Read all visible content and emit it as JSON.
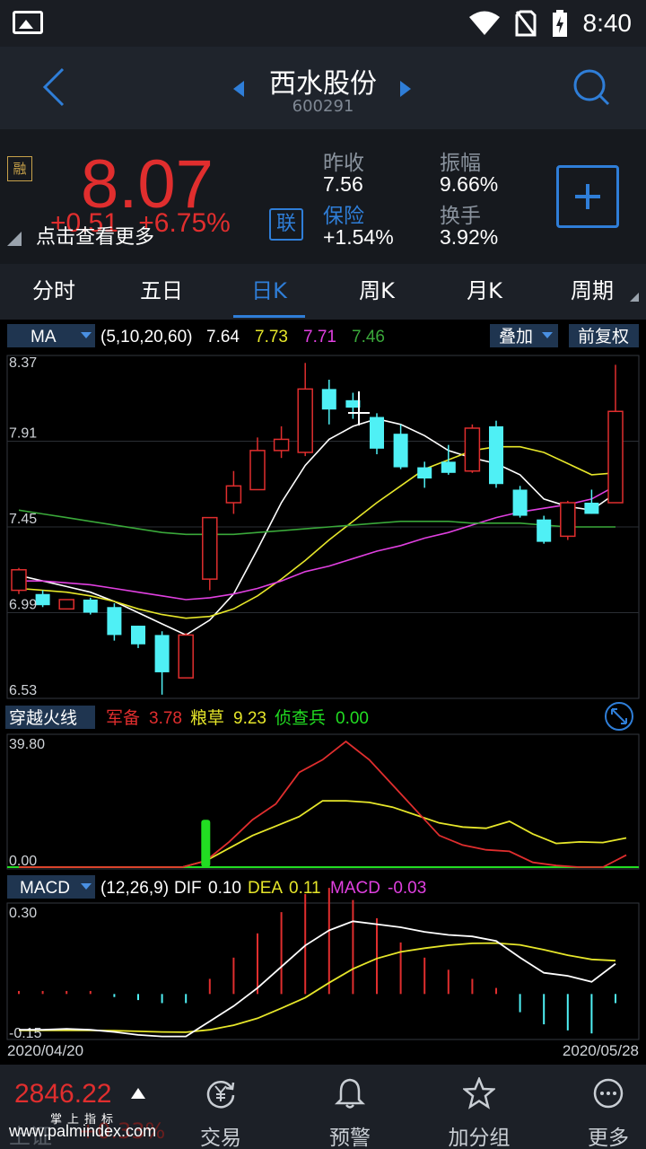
{
  "status": {
    "time": "8:40"
  },
  "header": {
    "title": "西水股份",
    "code": "600291"
  },
  "quote": {
    "rong": "融",
    "price": "8.07",
    "change": "+0.51",
    "change_pct": "+6.75%",
    "tip": "点击查看更多",
    "lian": "联",
    "stats": [
      {
        "label": "昨收",
        "value": "7.56"
      },
      {
        "label": "振幅",
        "value": "9.66%"
      },
      {
        "label": "保险",
        "value": "+1.54%"
      },
      {
        "label": "换手",
        "value": "3.92%"
      }
    ]
  },
  "tabs": [
    "分时",
    "五日",
    "日K",
    "周K",
    "月K",
    "周期"
  ],
  "active_tab": "日K",
  "ma_bar": {
    "name": "MA",
    "params": "(5,10,20,60)",
    "values": [
      "7.64",
      "7.73",
      "7.71",
      "7.46"
    ],
    "overlay": "叠加",
    "adjust": "前复权"
  },
  "ind1": {
    "name": "穿越火线",
    "items": [
      {
        "label": "军备",
        "value": "3.78"
      },
      {
        "label": "粮草",
        "value": "9.23"
      },
      {
        "label": "侦查兵",
        "value": "0.00"
      }
    ],
    "top": "39.80",
    "bottom": "0.00"
  },
  "macd": {
    "name": "MACD",
    "params": "(12,26,9)",
    "dif_label": "DIF",
    "dif": "0.10",
    "dea_label": "DEA",
    "dea": "0.11",
    "macd_label": "MACD",
    "macd": "-0.03",
    "top": "0.30",
    "bottom": "-0.15",
    "date_start": "2020/04/20",
    "date_end": "2020/05/28"
  },
  "colors": {
    "up": "#e02e2e",
    "down": "#4ff0f5",
    "ma5": "#ffffff",
    "ma10": "#e6e62a",
    "ma20": "#e040e0",
    "ma60": "#3aa83a",
    "accent": "#2f7ed8"
  },
  "chart_data": {
    "type": "candlestick",
    "y_ticks": [
      "8.37",
      "7.91",
      "7.45",
      "6.99",
      "6.53"
    ],
    "ylim": [
      6.53,
      8.37
    ],
    "candles": [
      {
        "o": 7.11,
        "c": 7.22,
        "h": 7.23,
        "l": 7.09
      },
      {
        "o": 7.09,
        "c": 7.03,
        "h": 7.11,
        "l": 7.02
      },
      {
        "o": 7.01,
        "c": 7.06,
        "h": 7.06,
        "l": 7.01
      },
      {
        "o": 7.06,
        "c": 6.99,
        "h": 7.07,
        "l": 6.98
      },
      {
        "o": 7.02,
        "c": 6.87,
        "h": 7.04,
        "l": 6.84
      },
      {
        "o": 6.92,
        "c": 6.82,
        "h": 6.92,
        "l": 6.8
      },
      {
        "o": 6.87,
        "c": 6.67,
        "h": 6.89,
        "l": 6.55
      },
      {
        "o": 6.64,
        "c": 6.87,
        "h": 6.88,
        "l": 6.64
      },
      {
        "o": 7.17,
        "c": 7.5,
        "h": 7.5,
        "l": 7.11
      },
      {
        "o": 7.58,
        "c": 7.67,
        "h": 7.75,
        "l": 7.52
      },
      {
        "o": 7.65,
        "c": 7.86,
        "h": 7.93,
        "l": 7.65
      },
      {
        "o": 7.86,
        "c": 7.92,
        "h": 7.99,
        "l": 7.82
      },
      {
        "o": 7.85,
        "c": 8.19,
        "h": 8.33,
        "l": 7.83
      },
      {
        "o": 8.19,
        "c": 8.08,
        "h": 8.24,
        "l": 8.0
      },
      {
        "o": 8.13,
        "c": 8.09,
        "h": 8.17,
        "l": 8.03
      },
      {
        "o": 8.04,
        "c": 7.87,
        "h": 8.06,
        "l": 7.84
      },
      {
        "o": 7.95,
        "c": 7.77,
        "h": 8.0,
        "l": 7.76
      },
      {
        "o": 7.77,
        "c": 7.71,
        "h": 7.8,
        "l": 7.66
      },
      {
        "o": 7.8,
        "c": 7.74,
        "h": 7.89,
        "l": 7.73
      },
      {
        "o": 7.75,
        "c": 7.98,
        "h": 8.0,
        "l": 7.74
      },
      {
        "o": 7.99,
        "c": 7.68,
        "h": 8.02,
        "l": 7.66
      },
      {
        "o": 7.65,
        "c": 7.51,
        "h": 7.67,
        "l": 7.5
      },
      {
        "o": 7.49,
        "c": 7.37,
        "h": 7.51,
        "l": 7.36
      },
      {
        "o": 7.4,
        "c": 7.58,
        "h": 7.59,
        "l": 7.38
      },
      {
        "o": 7.58,
        "c": 7.52,
        "h": 7.65,
        "l": 7.52
      },
      {
        "o": 7.58,
        "c": 8.07,
        "h": 8.32,
        "l": 7.58
      }
    ],
    "ma": [
      {
        "name": "MA5",
        "color": "#ffffff",
        "values": [
          7.19,
          7.16,
          7.13,
          7.1,
          7.05,
          6.99,
          6.93,
          6.87,
          6.95,
          7.09,
          7.33,
          7.58,
          7.78,
          7.92,
          7.99,
          8.03,
          8.0,
          7.94,
          7.86,
          7.82,
          7.79,
          7.73,
          7.6,
          7.56,
          7.54,
          7.63
        ]
      },
      {
        "name": "MA10",
        "color": "#e6e62a",
        "values": [
          7.12,
          7.11,
          7.1,
          7.08,
          7.05,
          7.01,
          6.98,
          6.96,
          6.97,
          7.01,
          7.08,
          7.17,
          7.27,
          7.38,
          7.48,
          7.58,
          7.67,
          7.76,
          7.81,
          7.86,
          7.88,
          7.88,
          7.85,
          7.79,
          7.73,
          7.74
        ]
      },
      {
        "name": "MA20",
        "color": "#e040e0",
        "values": [
          7.16,
          7.16,
          7.15,
          7.14,
          7.12,
          7.1,
          7.08,
          7.06,
          7.07,
          7.09,
          7.12,
          7.16,
          7.21,
          7.24,
          7.28,
          7.32,
          7.35,
          7.39,
          7.42,
          7.46,
          7.5,
          7.53,
          7.55,
          7.57,
          7.6,
          7.67
        ]
      },
      {
        "name": "MA60",
        "color": "#3aa83a",
        "values": [
          7.54,
          7.52,
          7.5,
          7.48,
          7.46,
          7.44,
          7.42,
          7.41,
          7.41,
          7.41,
          7.42,
          7.43,
          7.44,
          7.45,
          7.46,
          7.47,
          7.48,
          7.48,
          7.48,
          7.47,
          7.47,
          7.47,
          7.46,
          7.45,
          7.45,
          7.45
        ]
      }
    ],
    "ind1": {
      "ylim": [
        0,
        39.8
      ],
      "red": [
        0,
        0,
        0,
        0,
        0,
        0,
        0,
        0,
        2,
        8,
        15,
        20,
        30,
        34,
        39.8,
        34,
        26,
        18,
        10,
        7,
        5.5,
        5,
        1.5,
        0.5,
        0,
        0,
        3.8
      ],
      "yellow": [
        0,
        0,
        0,
        0,
        0,
        0,
        0,
        0,
        2,
        6,
        10,
        13,
        16,
        21,
        21,
        20.5,
        19,
        16.5,
        14,
        12.7,
        12.3,
        14.5,
        10.5,
        7.5,
        8,
        7.8,
        9.23
      ],
      "green_bar_index": 8,
      "green_bar_value": 15
    },
    "macd": {
      "ylim": [
        -0.15,
        0.3
      ],
      "dif": [
        -0.118,
        -0.118,
        -0.115,
        -0.118,
        -0.125,
        -0.135,
        -0.14,
        -0.14,
        -0.09,
        -0.04,
        0.02,
        0.09,
        0.16,
        0.21,
        0.24,
        0.23,
        0.22,
        0.205,
        0.195,
        0.19,
        0.175,
        0.12,
        0.07,
        0.06,
        0.04,
        0.1
      ],
      "dea": [
        -0.12,
        -0.12,
        -0.12,
        -0.12,
        -0.121,
        -0.123,
        -0.125,
        -0.126,
        -0.118,
        -0.103,
        -0.08,
        -0.047,
        -0.012,
        0.037,
        0.083,
        0.117,
        0.139,
        0.151,
        0.161,
        0.167,
        0.168,
        0.162,
        0.146,
        0.128,
        0.114,
        0.11
      ],
      "hist": [
        0.01,
        0.01,
        0.01,
        0.01,
        -0.01,
        -0.02,
        -0.03,
        -0.03,
        0.05,
        0.12,
        0.2,
        0.27,
        0.33,
        0.35,
        0.31,
        0.25,
        0.17,
        0.12,
        0.08,
        0.05,
        0.02,
        -0.06,
        -0.1,
        -0.12,
        -0.13,
        -0.03
      ]
    }
  },
  "bottom": {
    "index_value": "2846.22",
    "index_name": "上证",
    "index_pct": "+0.33%",
    "watermark1": "掌上指标",
    "watermark2": "www.palmindex.com",
    "nav": [
      {
        "label": "交易"
      },
      {
        "label": "预警"
      },
      {
        "label": "加分组"
      },
      {
        "label": "更多"
      }
    ]
  }
}
